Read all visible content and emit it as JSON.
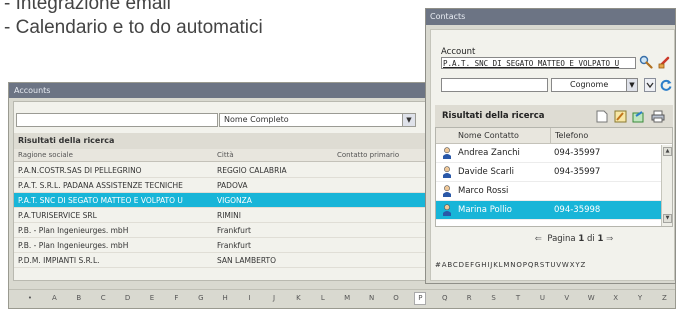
{
  "slide": {
    "bullets": [
      "- Integrazione email",
      "- Calendario e to do automatici"
    ]
  },
  "accounts": {
    "title": "Accounts",
    "search_value": "",
    "search_mode": "Nome Completo",
    "results_title": "Risultati della ricerca",
    "columns": [
      "Ragione sociale",
      "Città",
      "Contatto primario"
    ],
    "rows": [
      {
        "name": "P.A.N.COSTR.SAS DI PELLEGRINO",
        "city": "REGGIO CALABRIA",
        "contact": ""
      },
      {
        "name": "P.A.T. S.R.L. PADANA ASSISTENZE TECNICHE",
        "city": "PADOVA",
        "contact": ""
      },
      {
        "name": "P.A.T. SNC DI SEGATO MATTEO E VOLPATO U",
        "city": "VIGONZA",
        "contact": ""
      },
      {
        "name": "P.A.TURISERVICE SRL",
        "city": "RIMINI",
        "contact": ""
      },
      {
        "name": "P.B. - Plan Ingenieurges. mbH",
        "city": "Frankfurt",
        "contact": ""
      },
      {
        "name": "P.B. - Plan Ingenieurges. mbH",
        "city": "Frankfurt",
        "contact": ""
      },
      {
        "name": "P.D.M. IMPIANTI S.R.L.",
        "city": "SAN LAMBERTO",
        "contact": ""
      }
    ],
    "selected_row": 2,
    "alphabet": [
      "•",
      "A",
      "B",
      "C",
      "D",
      "E",
      "F",
      "G",
      "H",
      "I",
      "J",
      "K",
      "L",
      "M",
      "N",
      "O",
      "P",
      "Q",
      "R",
      "S",
      "T",
      "U",
      "V",
      "W",
      "X",
      "Y",
      "Z"
    ],
    "active_letter": "P"
  },
  "contacts": {
    "title": "Contacts",
    "account_label": "Account",
    "account_value": "P.A.T. SNC DI SEGATO MATTEO E VOLPATO U",
    "search_value": "",
    "search_mode": "Cognome",
    "results_title": "Risultati della ricerca",
    "columns": [
      "Nome Contatto",
      "Telefono"
    ],
    "rows": [
      {
        "name": "Andrea Zanchi",
        "phone": "094-35997"
      },
      {
        "name": "Davide Scarli",
        "phone": "094-35997"
      },
      {
        "name": "Marco Rossi",
        "phone": ""
      },
      {
        "name": "Marina Pollio",
        "phone": "094-35998"
      }
    ],
    "selected_row": 3,
    "pager_prefix": "Pagina",
    "pager_current": "1",
    "pager_sep": "di",
    "pager_total": "1",
    "alphabet": "#ABCDEFGHIJKLMNOPQRSTUVWXYZ"
  },
  "colors": {
    "selection": "#18b5d8",
    "titlebar": "#6c7484",
    "window_bg": "#d9d9d0"
  }
}
